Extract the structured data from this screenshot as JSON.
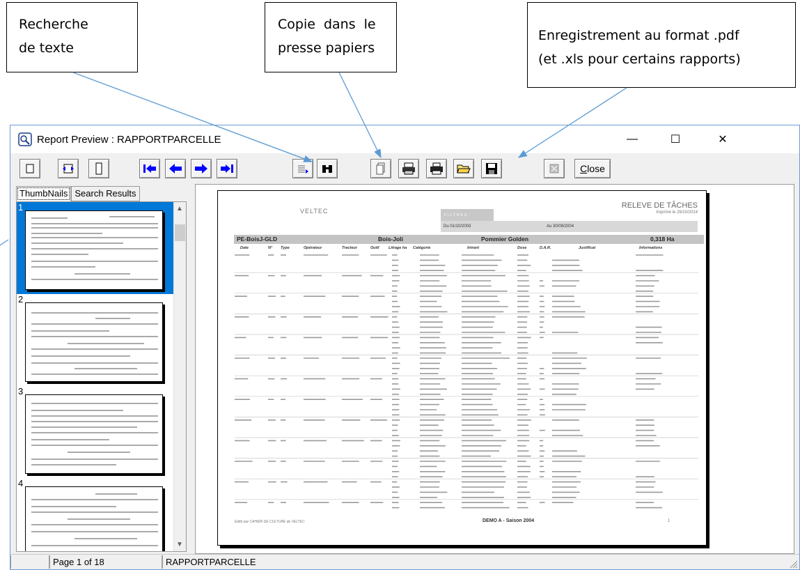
{
  "callouts": {
    "search": {
      "line1": "Recherche",
      "line2": "de texte"
    },
    "copy": {
      "line1": "Copie dans le",
      "line2": "presse papiers"
    },
    "save": {
      "line1": "Enregistrement au format .pdf",
      "line2": "(et .xls pour certains rapports)"
    }
  },
  "window": {
    "title": "Report Preview : RAPPORTPARCELLE",
    "controls": {
      "minimize": "—",
      "maximize": "☐",
      "close": "✕"
    }
  },
  "toolbar": {
    "close_label": "Close",
    "close_accel": "C",
    "close_rest": "lose"
  },
  "tabs": [
    {
      "label": "ThumbNails",
      "active": true
    },
    {
      "label": "Search Results",
      "active": false
    }
  ],
  "thumbnails": [
    {
      "number": "1",
      "selected": true
    },
    {
      "number": "2",
      "selected": false
    },
    {
      "number": "3",
      "selected": false
    },
    {
      "number": "4",
      "selected": false
    }
  ],
  "report": {
    "company": "VELTEC",
    "title": "RELEVE DE TÂCHES",
    "printed": "Imprimé le 29/10/2014",
    "section_label": "FILTRES",
    "period_from": "Du 01/10/2003",
    "period_to": "Au 30/09/2004",
    "parcel": "PE-BoisJ-GLD",
    "site": "Bois-Joli",
    "variety": "Pommier Golden",
    "area": "0,318 Ha",
    "columns": [
      "Date",
      "N°",
      "Type",
      "Opérateur",
      "Tracteur",
      "Outil",
      "Litrage ha",
      "Catégorie",
      "Intrant",
      "Dose",
      "D.A.R.",
      "Justificat",
      "Informations"
    ],
    "footer_left": "Edité par CAHIER DE CULTURE de VELTEC",
    "footer_center": "DEMO A - Saison 2004",
    "footer_page": "1"
  },
  "status": {
    "page": "Page 1 of 18",
    "report_name": "RAPPORTPARCELLE"
  },
  "colors": {
    "accent_blue": "#0000ff",
    "selection": "#0078d7",
    "arrow": "#5b9bd5"
  }
}
